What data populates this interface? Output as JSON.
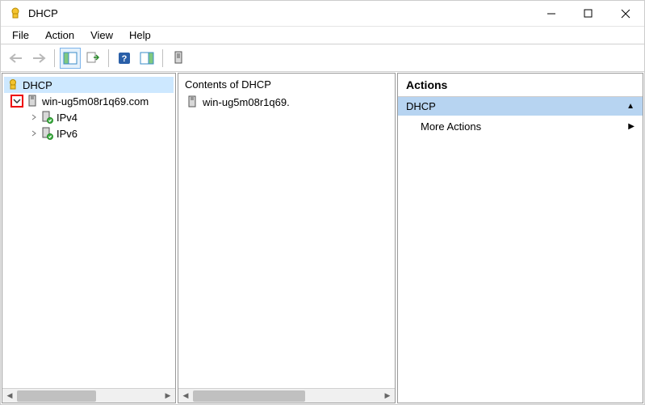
{
  "window": {
    "title": "DHCP"
  },
  "menu": {
    "file": "File",
    "action": "Action",
    "view": "View",
    "help": "Help"
  },
  "tree": {
    "root_label": "DHCP",
    "server_label": "win-ug5m08r1q69.com",
    "ipv4_label": "IPv4",
    "ipv6_label": "IPv6"
  },
  "contents": {
    "header": "Contents of DHCP",
    "item1": "win-ug5m08r1q69."
  },
  "actions": {
    "header": "Actions",
    "group": "DHCP",
    "more_actions": "More Actions"
  }
}
